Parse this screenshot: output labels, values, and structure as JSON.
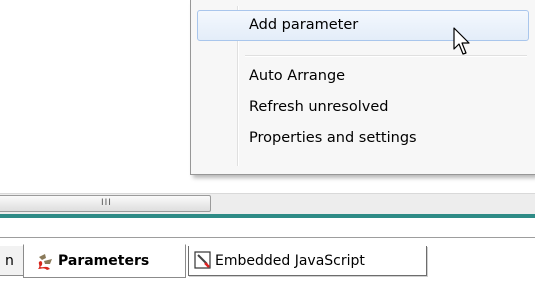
{
  "context_menu": {
    "items": [
      {
        "label": "Add parameter",
        "highlighted": true
      },
      {
        "label": "Auto Arrange"
      },
      {
        "label": "Refresh unresolved"
      },
      {
        "label": "Properties and settings"
      }
    ]
  },
  "scrollbar": {
    "grip": "III"
  },
  "tabs": [
    {
      "label": "n",
      "icon": "truncated-tab",
      "active": false
    },
    {
      "label": "Parameters",
      "icon": "parameters-icon",
      "active": true
    },
    {
      "label": "Embedded JavaScript",
      "icon": "javascript-document-icon",
      "active": false
    }
  ],
  "colors": {
    "menu_background": "#f7f7f7",
    "highlight_border": "#a9c6ec",
    "teal_bar": "#2e8b86"
  }
}
